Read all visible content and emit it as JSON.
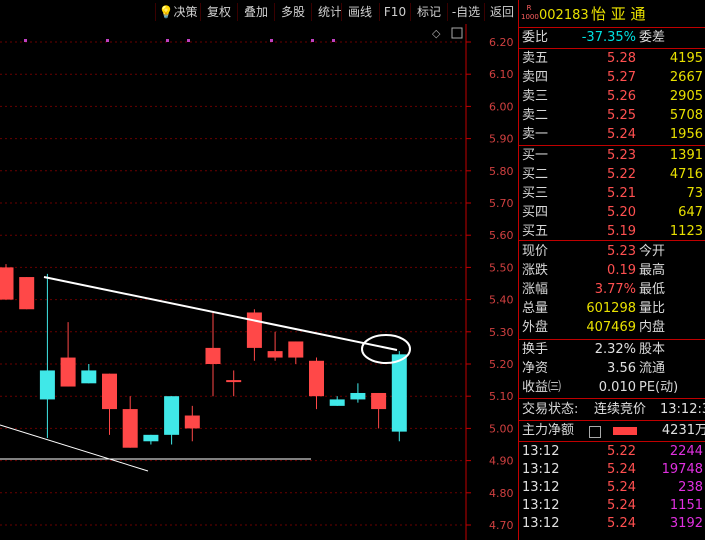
{
  "toolbar": {
    "buttons": [
      {
        "label": "决策",
        "icon": "lightbulb-icon"
      },
      {
        "label": "复权"
      },
      {
        "label": "叠加"
      },
      {
        "label": "多股"
      },
      {
        "label": "统计"
      },
      {
        "label": "画线"
      },
      {
        "label": "F10"
      },
      {
        "label": "标记"
      },
      {
        "label": "-自选"
      },
      {
        "label": "返回"
      }
    ]
  },
  "stock": {
    "badge_top": "R",
    "badge_bottom": "1000",
    "code": "002183",
    "name": "怡 亚 通"
  },
  "quote": {
    "wb_label": "委比",
    "wb_value": "-37.35%",
    "wc_label": "委差",
    "asks": [
      {
        "label": "卖五",
        "price": "5.28",
        "vol": "4195"
      },
      {
        "label": "卖四",
        "price": "5.27",
        "vol": "2667"
      },
      {
        "label": "卖三",
        "price": "5.26",
        "vol": "2905"
      },
      {
        "label": "卖二",
        "price": "5.25",
        "vol": "5708"
      },
      {
        "label": "卖一",
        "price": "5.24",
        "vol": "1956"
      }
    ],
    "bids": [
      {
        "label": "买一",
        "price": "5.23",
        "vol": "1391"
      },
      {
        "label": "买二",
        "price": "5.22",
        "vol": "4716"
      },
      {
        "label": "买三",
        "price": "5.21",
        "vol": "73"
      },
      {
        "label": "买四",
        "price": "5.20",
        "vol": "647"
      },
      {
        "label": "买五",
        "price": "5.19",
        "vol": "1123"
      }
    ],
    "stats": [
      {
        "label": "现价",
        "value": "5.23",
        "label2": "今开"
      },
      {
        "label": "涨跌",
        "value": "0.19",
        "label2": "最高"
      },
      {
        "label": "涨幅",
        "value": "3.77%",
        "label2": "最低"
      },
      {
        "label": "总量",
        "value": "601298",
        "label2": "量比"
      },
      {
        "label": "外盘",
        "value": "407469",
        "label2": "内盘"
      }
    ],
    "stats2": [
      {
        "label": "换手",
        "value": "2.32%",
        "label2": "股本"
      },
      {
        "label": "净资",
        "value": "3.56",
        "label2": "流通"
      },
      {
        "label": "收益㈢",
        "value": "0.010",
        "label2": "PE(动)"
      }
    ],
    "trade_status_label": "交易状态:",
    "trade_status_value": "连续竞价",
    "trade_time": "13:12:3",
    "main_net_label": "主力净额",
    "main_net_value": "4231万",
    "ticks": [
      {
        "time": "13:12",
        "price": "5.22",
        "vol": "2244"
      },
      {
        "time": "13:12",
        "price": "5.24",
        "vol": "19748"
      },
      {
        "time": "13:12",
        "price": "5.24",
        "vol": "238"
      },
      {
        "time": "13:12",
        "price": "5.24",
        "vol": "1151"
      },
      {
        "time": "13:12",
        "price": "5.24",
        "vol": "3192"
      }
    ]
  },
  "chart_data": {
    "type": "candlestick",
    "y_ticks": [
      "6.20",
      "6.10",
      "6.00",
      "5.90",
      "5.80",
      "5.70",
      "5.60",
      "5.50",
      "5.40",
      "5.30",
      "5.20",
      "5.10",
      "5.00",
      "4.90",
      "4.80",
      "4.70"
    ],
    "ylim": [
      4.66,
      6.25
    ],
    "candles": [
      {
        "o": 5.4,
        "c": 5.5,
        "h": 5.51,
        "l": 5.4
      },
      {
        "o": 5.37,
        "c": 5.47,
        "h": 5.47,
        "l": 5.37
      },
      {
        "o": 5.18,
        "c": 5.09,
        "h": 5.48,
        "l": 4.97
      },
      {
        "o": 5.13,
        "c": 5.22,
        "h": 5.33,
        "l": 5.13
      },
      {
        "o": 5.18,
        "c": 5.14,
        "h": 5.2,
        "l": 5.14
      },
      {
        "o": 5.06,
        "c": 5.17,
        "h": 5.17,
        "l": 4.98
      },
      {
        "o": 4.94,
        "c": 5.06,
        "h": 5.1,
        "l": 4.94
      },
      {
        "o": 4.98,
        "c": 4.96,
        "h": 4.98,
        "l": 4.95
      },
      {
        "o": 5.1,
        "c": 4.98,
        "h": 5.1,
        "l": 4.95
      },
      {
        "o": 5.0,
        "c": 5.04,
        "h": 5.07,
        "l": 4.96
      },
      {
        "o": 5.2,
        "c": 5.25,
        "h": 5.36,
        "l": 5.1
      },
      {
        "o": 5.15,
        "c": 5.15,
        "h": 5.18,
        "l": 5.1
      },
      {
        "o": 5.25,
        "c": 5.36,
        "h": 5.37,
        "l": 5.21
      },
      {
        "o": 5.22,
        "c": 5.24,
        "h": 5.3,
        "l": 5.21
      },
      {
        "o": 5.22,
        "c": 5.27,
        "h": 5.27,
        "l": 5.2
      },
      {
        "o": 5.1,
        "c": 5.21,
        "h": 5.22,
        "l": 5.06
      },
      {
        "o": 5.09,
        "c": 5.07,
        "h": 5.1,
        "l": 5.07
      },
      {
        "o": 5.11,
        "c": 5.09,
        "h": 5.14,
        "l": 5.08
      },
      {
        "o": 5.06,
        "c": 5.11,
        "h": 5.11,
        "l": 5.0
      },
      {
        "o": 5.23,
        "c": 4.99,
        "h": 5.24,
        "l": 4.96
      }
    ]
  }
}
